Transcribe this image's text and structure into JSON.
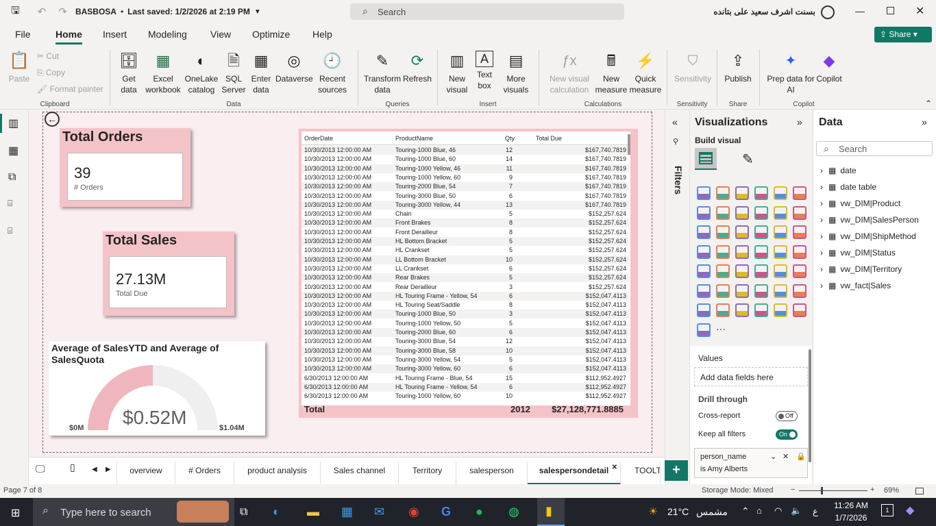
{
  "titlebar": {
    "file_name": "BASBOSA",
    "saved": "Last saved: 1/2/2026 at 2:19 PM",
    "search": "Search",
    "user": "بسنت اشرف سعيد على بتانده"
  },
  "menu": [
    "File",
    "Home",
    "Insert",
    "Modeling",
    "View",
    "Optimize",
    "Help"
  ],
  "share": "Share",
  "ribbon": {
    "clipboard": [
      "Paste",
      "Cut",
      "Copy",
      "Format painter"
    ],
    "data": [
      "Get data",
      "Excel workbook",
      "OneLake catalog",
      "SQL Server",
      "Enter data",
      "Dataverse",
      "Recent sources"
    ],
    "queries": [
      "Transform data",
      "Refresh"
    ],
    "insert": [
      "New visual",
      "Text box",
      "More visuals"
    ],
    "calc": [
      "New visual calculation",
      "New measure",
      "Quick measure"
    ],
    "other": [
      "Sensitivity",
      "Publish",
      "Prep data for AI",
      "Copilot"
    ],
    "groups": [
      "Clipboard",
      "Data",
      "Queries",
      "Insert",
      "Calculations",
      "Sensitivity",
      "Share",
      "Copilot"
    ]
  },
  "cards": {
    "orders": {
      "title": "Total Orders",
      "value": "39",
      "label": "# Orders"
    },
    "sales": {
      "title": "Total Sales",
      "value": "27.13M",
      "label": "Total Due"
    },
    "gauge": {
      "title": "Average of SalesYTD and Average of SalesQuota",
      "value": "$0.52M",
      "min": "$0M",
      "max": "$1.04M",
      "fill": 0.5
    }
  },
  "table": {
    "headers": [
      "OrderDate",
      "ProductName",
      "Qty",
      "Total Due"
    ],
    "rows": [
      [
        "10/30/2013 12:00:00 AM",
        "Touring-1000 Blue, 46",
        "12",
        "$167,740.7819"
      ],
      [
        "10/30/2013 12:00:00 AM",
        "Touring-1000 Blue, 60",
        "14",
        "$167,740.7819"
      ],
      [
        "10/30/2013 12:00:00 AM",
        "Touring-1000 Yellow, 46",
        "11",
        "$167,740.7819"
      ],
      [
        "10/30/2013 12:00:00 AM",
        "Touring-1000 Yellow, 60",
        "9",
        "$167,740.7819"
      ],
      [
        "10/30/2013 12:00:00 AM",
        "Touring-2000 Blue, 54",
        "7",
        "$167,740.7819"
      ],
      [
        "10/30/2013 12:00:00 AM",
        "Touring-3000 Blue, 50",
        "6",
        "$167,740.7819"
      ],
      [
        "10/30/2013 12:00:00 AM",
        "Touring-3000 Yellow, 44",
        "13",
        "$167,740.7819"
      ],
      [
        "10/30/2013 12:00:00 AM",
        "Chain",
        "5",
        "$152,257.624"
      ],
      [
        "10/30/2013 12:00:00 AM",
        "Front Brakes",
        "8",
        "$152,257.624"
      ],
      [
        "10/30/2013 12:00:00 AM",
        "Front Derailleur",
        "8",
        "$152,257.624"
      ],
      [
        "10/30/2013 12:00:00 AM",
        "HL Bottom Bracket",
        "5",
        "$152,257.624"
      ],
      [
        "10/30/2013 12:00:00 AM",
        "HL Crankset",
        "5",
        "$152,257.624"
      ],
      [
        "10/30/2013 12:00:00 AM",
        "LL Bottom Bracket",
        "10",
        "$152,257.624"
      ],
      [
        "10/30/2013 12:00:00 AM",
        "LL Crankset",
        "6",
        "$152,257.624"
      ],
      [
        "10/30/2013 12:00:00 AM",
        "Rear Brakes",
        "5",
        "$152,257.624"
      ],
      [
        "10/30/2013 12:00:00 AM",
        "Rear Derailleur",
        "3",
        "$152,257.624"
      ],
      [
        "10/30/2013 12:00:00 AM",
        "HL Touring Frame - Yellow, 54",
        "6",
        "$152,047.4113"
      ],
      [
        "10/30/2013 12:00:00 AM",
        "HL Touring Seat/Saddle",
        "8",
        "$152,047.4113"
      ],
      [
        "10/30/2013 12:00:00 AM",
        "Touring-1000 Blue, 50",
        "3",
        "$152,047.4113"
      ],
      [
        "10/30/2013 12:00:00 AM",
        "Touring-1000 Yellow, 50",
        "5",
        "$152,047.4113"
      ],
      [
        "10/30/2013 12:00:00 AM",
        "Touring-2000 Blue, 60",
        "6",
        "$152,047.4113"
      ],
      [
        "10/30/2013 12:00:00 AM",
        "Touring-3000 Blue, 54",
        "12",
        "$152,047.4113"
      ],
      [
        "10/30/2013 12:00:00 AM",
        "Touring-3000 Blue, 58",
        "10",
        "$152,047.4113"
      ],
      [
        "10/30/2013 12:00:00 AM",
        "Touring-3000 Yellow, 54",
        "5",
        "$152,047.4113"
      ],
      [
        "10/30/2013 12:00:00 AM",
        "Touring-3000 Yellow, 60",
        "6",
        "$152,047.4113"
      ],
      [
        "6/30/2013 12:00:00 AM",
        "HL Touring Frame - Blue, 54",
        "15",
        "$112,952.4927"
      ],
      [
        "6/30/2013 12:00:00 AM",
        "HL Touring Frame - Yellow, 54",
        "6",
        "$112,952.4927"
      ],
      [
        "6/30/2013 12:00:00 AM",
        "Touring-1000 Yellow, 60",
        "10",
        "$112,952.4927"
      ]
    ],
    "total_label": "Total",
    "total_qty": "2012",
    "total_due": "$27,128,771.8885"
  },
  "filters_label": "Filters",
  "viz": {
    "title": "Visualizations",
    "build": "Build visual",
    "values": "Values",
    "add_fields": "Add data fields here",
    "drill": "Drill through",
    "cross": "Cross-report",
    "cross_state": "Off",
    "keep": "Keep all filters",
    "keep_state": "On",
    "filter_field": "person_name",
    "filter_value": "is Amy Alberts"
  },
  "data_pane": {
    "title": "Data",
    "search": "Search",
    "items": [
      "date",
      "date table",
      "vw_DIM|Product",
      "vw_DIM|SalesPerson",
      "vw_DIM|ShipMethod",
      "vw_DIM|Status",
      "vw_DIM|Territory",
      "vw_fact|Sales"
    ]
  },
  "tabs": [
    "overview",
    "# Orders",
    "product analysis",
    "Sales channel",
    "Territory",
    "salesperson",
    "salespersondetail",
    "TOOLTI"
  ],
  "status": {
    "page": "Page 7 of 8",
    "storage": "Storage Mode: Mixed",
    "zoom": "69%"
  },
  "taskbar": {
    "search": "Type here to search",
    "weather": "21°C",
    "weather_text": "مشمس",
    "time": "11:26 AM",
    "date": "1/7/2026",
    "lang": "ع",
    "notif": "1"
  },
  "colors": {
    "accent": "#117865",
    "card": "#f4c3c8",
    "gauge": "#efb7bd"
  }
}
